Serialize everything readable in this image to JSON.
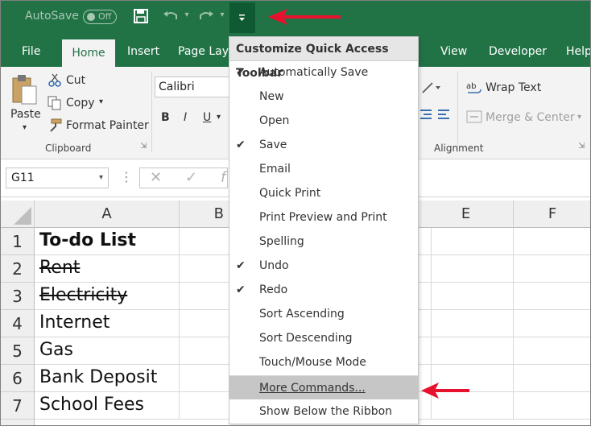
{
  "titlebar": {
    "autosave_label": "AutoSave",
    "autosave_state": "Off",
    "accent": "#217346"
  },
  "tabs": [
    "File",
    "Home",
    "Insert",
    "Page Layo",
    "View",
    "Developer",
    "Help"
  ],
  "ribbon": {
    "paste": "Paste",
    "cut": "Cut",
    "copy": "Copy",
    "format_painter": "Format Painter",
    "clipboard_label": "Clipboard",
    "font_name": "Calibri",
    "bold": "B",
    "italic": "I",
    "underline": "U",
    "wrap_text": "Wrap Text",
    "merge_center": "Merge & Center",
    "alignment_label": "Alignment"
  },
  "formula_bar": {
    "name_box": "G11"
  },
  "grid": {
    "columns": [
      "A",
      "B",
      "E",
      "F"
    ],
    "rows": [
      "1",
      "2",
      "3",
      "4",
      "5",
      "6",
      "7"
    ],
    "cells_a": [
      "To-do List",
      "Rent",
      "Electricity",
      "Internet",
      "Gas",
      "Bank Deposit",
      "School Fees"
    ]
  },
  "menu": {
    "title": "Customize Quick Access Toolbar",
    "items": [
      {
        "label": "Automatically Save",
        "checked": true
      },
      {
        "label": "New",
        "checked": false
      },
      {
        "label": "Open",
        "checked": false
      },
      {
        "label": "Save",
        "checked": true
      },
      {
        "label": "Email",
        "checked": false
      },
      {
        "label": "Quick Print",
        "checked": false
      },
      {
        "label": "Print Preview and Print",
        "checked": false
      },
      {
        "label": "Spelling",
        "checked": false
      },
      {
        "label": "Undo",
        "checked": true
      },
      {
        "label": "Redo",
        "checked": true
      },
      {
        "label": "Sort Ascending",
        "checked": false
      },
      {
        "label": "Sort Descending",
        "checked": false
      },
      {
        "label": "Touch/Mouse Mode",
        "checked": false
      },
      {
        "label": "More Commands...",
        "checked": false
      },
      {
        "label": "Show Below the Ribbon",
        "checked": false
      }
    ],
    "check_glyph": "✔"
  }
}
